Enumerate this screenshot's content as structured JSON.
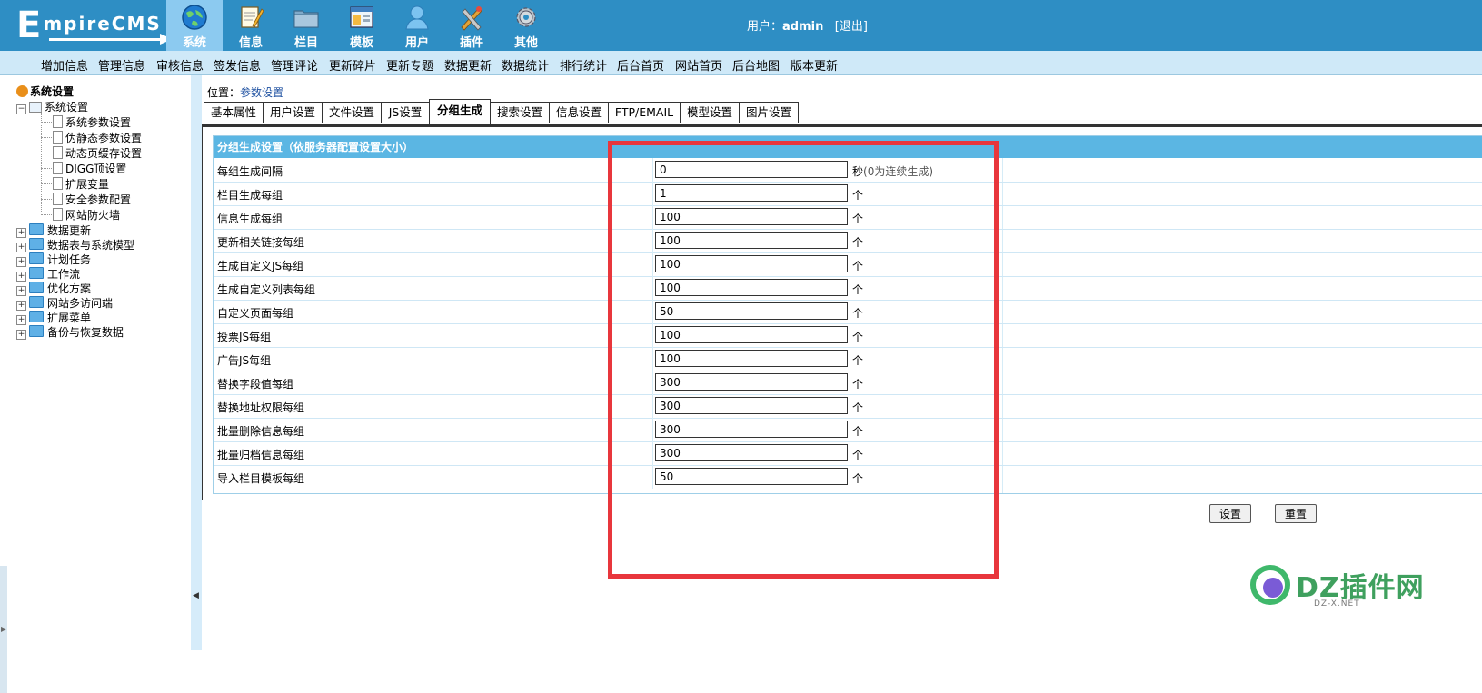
{
  "header": {
    "logo": "EmpireCMS",
    "nav": [
      {
        "label": "系统",
        "icon": "globe-icon",
        "active": true
      },
      {
        "label": "信息",
        "icon": "notepad-icon",
        "active": false
      },
      {
        "label": "栏目",
        "icon": "folder-icon",
        "active": false
      },
      {
        "label": "模板",
        "icon": "window-template-icon",
        "active": false
      },
      {
        "label": "用户",
        "icon": "user-icon",
        "active": false
      },
      {
        "label": "插件",
        "icon": "tools-icon",
        "active": false
      },
      {
        "label": "其他",
        "icon": "gear-icon",
        "active": false
      }
    ],
    "user_prefix": "用户：",
    "username": "admin",
    "logout": "[退出]"
  },
  "submenu": [
    "增加信息",
    "管理信息",
    "审核信息",
    "签发信息",
    "管理评论",
    "更新碎片",
    "更新专题",
    "数据更新",
    "数据统计",
    "排行统计",
    "后台首页",
    "网站首页",
    "后台地图",
    "版本更新"
  ],
  "sidebar": {
    "root": "系统设置",
    "group_open": "系统设置",
    "children": [
      "系统参数设置",
      "伪静态参数设置",
      "动态页缓存设置",
      "DIGG顶设置",
      "扩展变量",
      "安全参数配置",
      "网站防火墙"
    ],
    "groups": [
      "数据更新",
      "数据表与系统模型",
      "计划任务",
      "工作流",
      "优化方案",
      "网站多访问端",
      "扩展菜单",
      "备份与恢复数据"
    ]
  },
  "breadcrumb": {
    "prefix": "位置：",
    "link": "参数设置"
  },
  "tabs": [
    {
      "label": "基本属性",
      "active": false
    },
    {
      "label": "用户设置",
      "active": false
    },
    {
      "label": "文件设置",
      "active": false
    },
    {
      "label": "JS设置",
      "active": false
    },
    {
      "label": "分组生成",
      "active": true
    },
    {
      "label": "搜索设置",
      "active": false
    },
    {
      "label": "信息设置",
      "active": false
    },
    {
      "label": "FTP/EMAIL",
      "active": false
    },
    {
      "label": "模型设置",
      "active": false
    },
    {
      "label": "图片设置",
      "active": false
    }
  ],
  "panel": {
    "title": "分组生成设置（依服务器配置设置大小）",
    "rows": [
      {
        "label": "每组生成间隔",
        "value": "0",
        "unit": "秒",
        "note": "(0为连续生成)"
      },
      {
        "label": "栏目生成每组",
        "value": "1",
        "unit": "个",
        "note": ""
      },
      {
        "label": "信息生成每组",
        "value": "100",
        "unit": "个",
        "note": ""
      },
      {
        "label": "更新相关链接每组",
        "value": "100",
        "unit": "个",
        "note": ""
      },
      {
        "label": "生成自定义JS每组",
        "value": "100",
        "unit": "个",
        "note": ""
      },
      {
        "label": "生成自定义列表每组",
        "value": "100",
        "unit": "个",
        "note": ""
      },
      {
        "label": "自定义页面每组",
        "value": "50",
        "unit": "个",
        "note": ""
      },
      {
        "label": "投票JS每组",
        "value": "100",
        "unit": "个",
        "note": ""
      },
      {
        "label": "广告JS每组",
        "value": "100",
        "unit": "个",
        "note": ""
      },
      {
        "label": "替换字段值每组",
        "value": "300",
        "unit": "个",
        "note": ""
      },
      {
        "label": "替换地址权限每组",
        "value": "300",
        "unit": "个",
        "note": ""
      },
      {
        "label": "批量删除信息每组",
        "value": "300",
        "unit": "个",
        "note": ""
      },
      {
        "label": "批量归档信息每组",
        "value": "300",
        "unit": "个",
        "note": ""
      },
      {
        "label": "导入栏目模板每组",
        "value": "50",
        "unit": "个",
        "note": ""
      }
    ]
  },
  "buttons": {
    "submit": "设置",
    "reset": "重置"
  },
  "watermark": {
    "text": "DZ插件网",
    "sub": "DZ-X.NET"
  },
  "colors": {
    "header": "#2e8ec4",
    "submenu": "#cfe9f8",
    "panel_header": "#5bb6e3",
    "highlight": "#e8363c"
  }
}
